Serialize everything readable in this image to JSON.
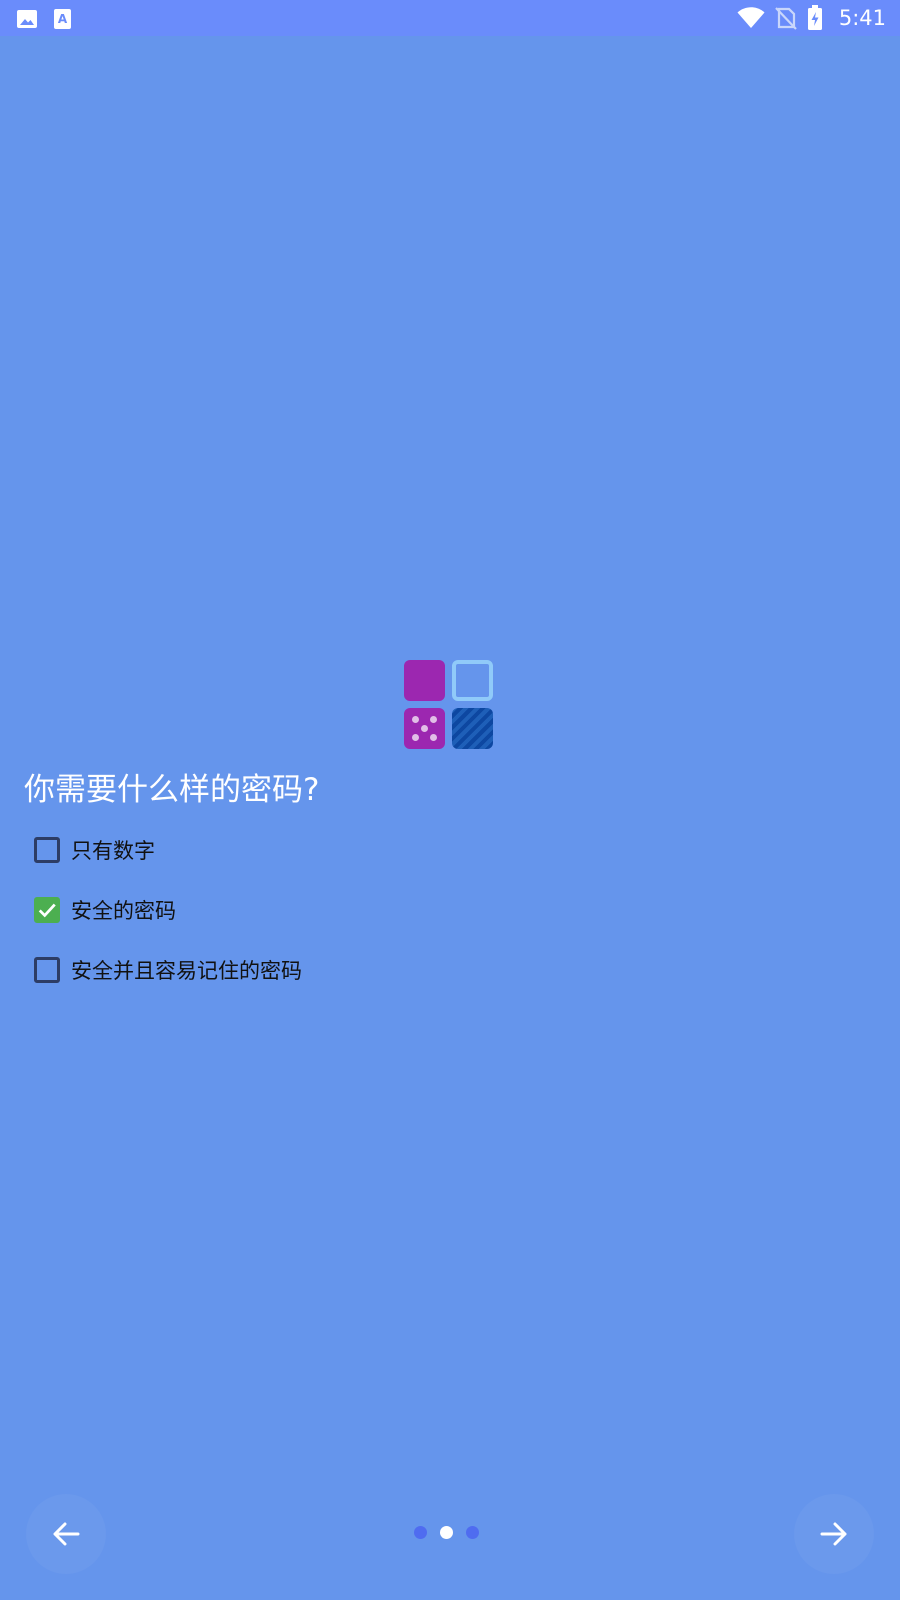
{
  "status_bar": {
    "time": "5:41",
    "left_icons": [
      "image-icon",
      "font-app-icon"
    ],
    "right_icons": [
      "wifi-icon",
      "no-sim-icon",
      "battery-charging-icon"
    ]
  },
  "wizard": {
    "question": "你需要什么样的密码?",
    "options": [
      {
        "label": "只有数字",
        "checked": false
      },
      {
        "label": "安全的密码",
        "checked": true
      },
      {
        "label": "安全并且容易记住的密码",
        "checked": false
      }
    ]
  },
  "navigation": {
    "back_icon": "arrow-left-icon",
    "next_icon": "arrow-right-icon",
    "page_count": 3,
    "current_page": 2
  },
  "colors": {
    "background": "#6595ec",
    "status_bar": "#6a8cfb",
    "checkbox_checked": "#4caf50",
    "logo_purple": "#9c27b0",
    "logo_light_blue": "#90caf9",
    "logo_dark_blue": "#0d47a1"
  }
}
